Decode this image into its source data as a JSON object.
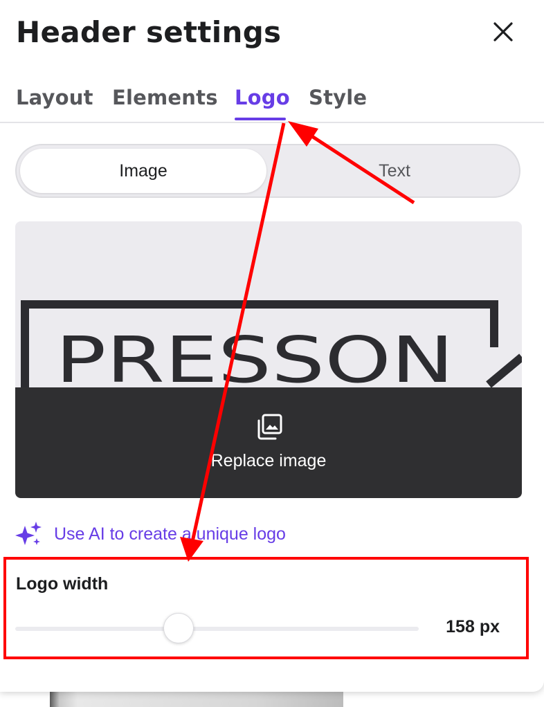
{
  "panel": {
    "title": "Header settings"
  },
  "tabs": [
    {
      "label": "Layout",
      "active": false
    },
    {
      "label": "Elements",
      "active": false
    },
    {
      "label": "Logo",
      "active": true
    },
    {
      "label": "Style",
      "active": false
    }
  ],
  "logo_type": {
    "options": [
      "Image",
      "Text"
    ],
    "selected": "Image"
  },
  "logo_preview": {
    "logo_text": "PRESSON",
    "replace_label": "Replace image",
    "replace_icon": "image-gallery-icon"
  },
  "ai_link": {
    "label": "Use AI to create a unique logo",
    "icon": "sparkles-icon"
  },
  "logo_width": {
    "label": "Logo width",
    "value": "158 px",
    "slider_fraction": 0.4
  },
  "colors": {
    "accent": "#673de6",
    "text": "#1d1e20",
    "muted_text": "#56575b",
    "overlay": "#2f2f31",
    "annotation": "#ff0000"
  }
}
